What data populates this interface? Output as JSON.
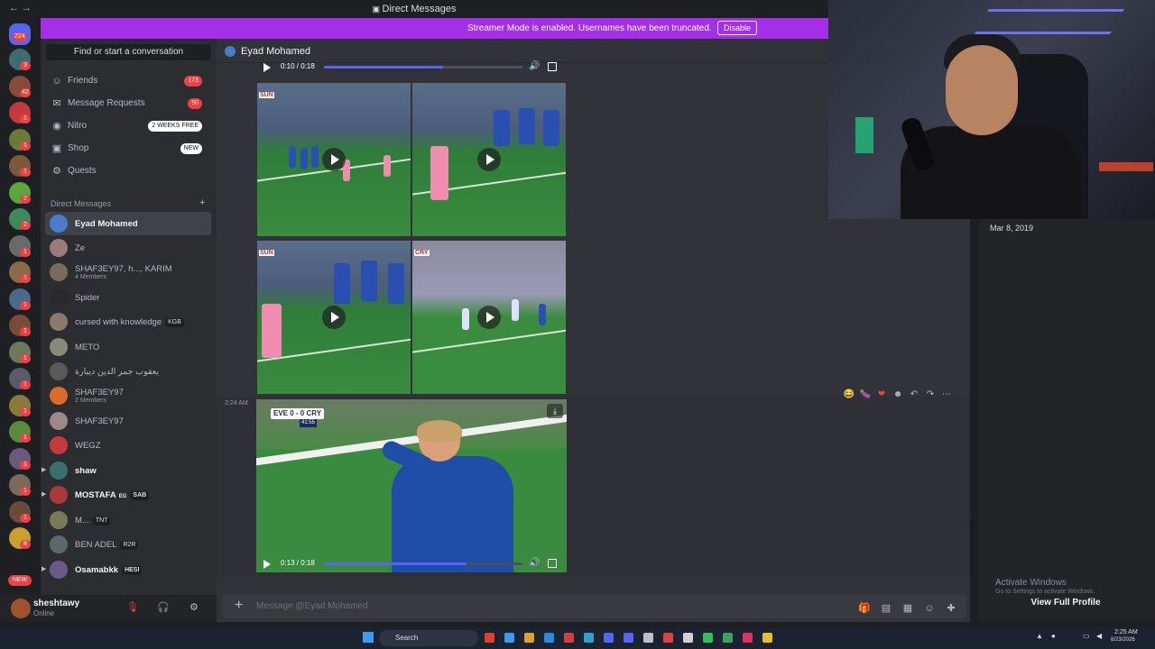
{
  "window": {
    "title": "Direct Messages",
    "nav_back": "←",
    "nav_forward": "→"
  },
  "banner": {
    "text": "Streamer Mode is enabled. Usernames have been truncated.",
    "button": "Disable",
    "color": "#a52ee8"
  },
  "rail": {
    "home_badge": "224",
    "servers": [
      {
        "badge": "3",
        "color": "#3b6e70"
      },
      {
        "badge": "42",
        "color": "#8a4a3a"
      },
      {
        "badge": "1",
        "color": "#c43a3a"
      },
      {
        "badge": "1",
        "color": "#6a7a3a"
      },
      {
        "badge": "1",
        "color": "#7a5a3a"
      },
      {
        "badge": "2",
        "color": "#5aa83a"
      },
      {
        "badge": "2",
        "color": "#3a8a5a"
      },
      {
        "badge": "1",
        "color": "#6a6a6a"
      },
      {
        "badge": "1",
        "color": "#8a6a4a"
      },
      {
        "badge": "1",
        "color": "#4a6a8a"
      },
      {
        "badge": "1",
        "color": "#7a4a3a"
      },
      {
        "badge": "1",
        "color": "#6a7a5a"
      },
      {
        "badge": "1",
        "color": "#5a5a6a"
      },
      {
        "badge": "1",
        "color": "#8a7a3a"
      },
      {
        "badge": "1",
        "color": "#5a8a3a"
      },
      {
        "badge": "1",
        "color": "#6a5a7a"
      },
      {
        "badge": "1",
        "color": "#7a6a5a"
      },
      {
        "badge": "1",
        "color": "#6a4a3a"
      },
      {
        "badge": "8",
        "color": "#c8a030"
      }
    ],
    "new_label": "NEW"
  },
  "sidebar": {
    "search_placeholder": "Find or start a conversation",
    "nav": [
      {
        "label": "Friends",
        "icon": "friends-icon",
        "glyph": "☺",
        "badge": "173"
      },
      {
        "label": "Message Requests",
        "icon": "mail-icon",
        "glyph": "✉",
        "badge": "50"
      },
      {
        "label": "Nitro",
        "icon": "nitro-icon",
        "glyph": "◉",
        "badge": "2 WEEKS FREE"
      },
      {
        "label": "Shop",
        "icon": "shop-icon",
        "glyph": "▣",
        "badge": "NEW"
      },
      {
        "label": "Quests",
        "icon": "quests-icon",
        "glyph": "⚙",
        "badge": ""
      }
    ],
    "dm_header": "Direct Messages",
    "dm_add": "+",
    "dms": [
      {
        "name": "Eyad Mohamed",
        "sub": "",
        "tag": "",
        "color": "#4a7cc9",
        "active": true,
        "bold": true
      },
      {
        "name": "Ze",
        "sub": "",
        "tag": "",
        "color": "#9a7a7a"
      },
      {
        "name": "SHAF3EY97, h..., KARIM",
        "sub": "4 Members",
        "tag": "",
        "color": "#7a6a5a"
      },
      {
        "name": "Spider",
        "sub": "",
        "tag": "",
        "color": "#2a2a2a"
      },
      {
        "name": "cursed with knowledge",
        "sub": "",
        "tag": "KGB",
        "color": "#8a7a6a"
      },
      {
        "name": "METO",
        "sub": "",
        "tag": "",
        "color": "#8a8a7a"
      },
      {
        "name": "يعقوب جمر الدين ديبارة",
        "sub": "",
        "tag": "",
        "color": "#5a5a5a"
      },
      {
        "name": "SHAF3EY97",
        "sub": "2 Members",
        "tag": "",
        "color": "#e06a2a"
      },
      {
        "name": "SHAF3EY97",
        "sub": "",
        "tag": "",
        "color": "#9a8a8a"
      },
      {
        "name": "WEGZ",
        "sub": "",
        "tag": "",
        "color": "#c43a3a"
      },
      {
        "name": "shaw",
        "sub": "",
        "tag": "",
        "color": "#3b6e70",
        "bold": true,
        "arrow": true
      },
      {
        "name": "MOSTAFA",
        "sub": "",
        "tag": "SAB",
        "color": "#aa3a3a",
        "bold": true,
        "arrow": true,
        "mid": "EG"
      },
      {
        "name": "M...",
        "sub": "",
        "tag": "TNT",
        "color": "#7a7a5a"
      },
      {
        "name": "BEN ADEL",
        "sub": "",
        "tag": "R2R",
        "color": "#5a6a6a"
      },
      {
        "name": "Osamabkk",
        "sub": "",
        "tag": "HESI",
        "color": "#6a5a8a",
        "bold": true,
        "arrow": true
      }
    ]
  },
  "user": {
    "name": "sheshtawy",
    "status": "Online",
    "mute_icon": "mic-muted-icon",
    "deafen_icon": "headphones-muted-icon",
    "settings_icon": "gear-icon"
  },
  "chat": {
    "header_name": "Eyad Mohamed",
    "top_video": {
      "time": "0:10 / 0:18",
      "progress": 0.6
    },
    "tiles": [
      {
        "tag": "SUN"
      },
      {
        "tag": ""
      },
      {
        "tag": "SUN"
      },
      {
        "tag": "CRY"
      }
    ],
    "message_time": "2:24 AM",
    "big_video": {
      "score": "EVE 0 - 0 CRY",
      "clock": "41:55",
      "time": "0:13 / 0:18",
      "progress": 0.72
    },
    "actions": [
      "😂",
      "🍆",
      "❤",
      "☻",
      "↶",
      "↷",
      "⋯"
    ]
  },
  "composer": {
    "placeholder": "Message @Eyad Mohamed",
    "plus": "+",
    "tools": [
      "gift-icon",
      "gif-icon",
      "sticker-icon",
      "emoji-icon",
      "apps-icon"
    ]
  },
  "profile": {
    "member_since": "Mar 8, 2019",
    "activate_line1": "Activate Windows",
    "activate_line2": "Go to Settings to activate Windows.",
    "view_full": "View Full Profile"
  },
  "taskbar": {
    "search": "Search",
    "time": "2:25 AM",
    "date": "8/23/2026",
    "apps": [
      "#e0402a",
      "#3a9bf0",
      "#e0a030",
      "#2a8ae0",
      "#d04040",
      "#30a0d0",
      "#5865f2",
      "#5865f2",
      "#c0c0c0",
      "#e04040",
      "#d0d0d0",
      "#30c060",
      "#40a060",
      "#e03060",
      "#e0c030"
    ]
  }
}
